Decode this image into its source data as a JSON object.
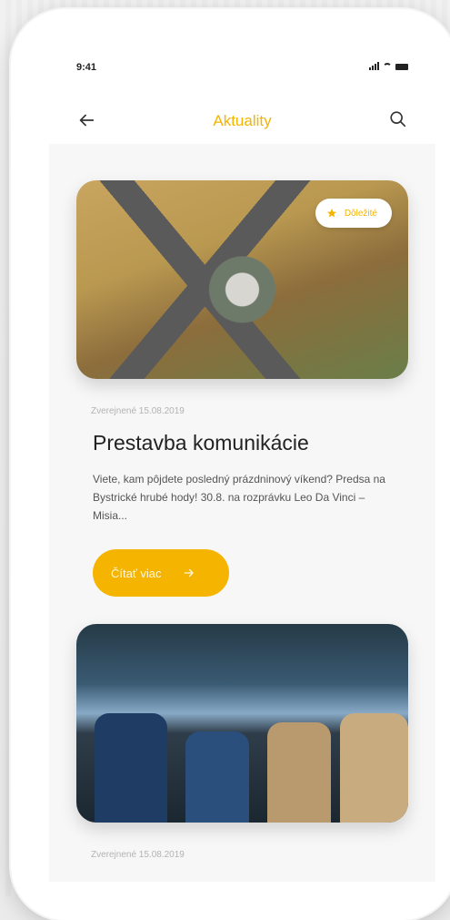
{
  "status": {
    "time": "9:41"
  },
  "header": {
    "title": "Aktuality"
  },
  "articles": [
    {
      "badge": "Dôležité",
      "meta": "Zverejnené 15.08.2019",
      "title": "Prestavba komunikácie",
      "excerpt": "Viete, kam pôjdete posledný prázdninový víkend? Predsa na Bystrické hrubé hody! 30.8. na rozprávku Leo Da Vinci – Misia...",
      "cta": "Čítať viac"
    },
    {
      "meta": "Zverejnené 15.08.2019",
      "title": ""
    }
  ],
  "colors": {
    "accent": "#f4b400",
    "background": "#f7f7f7"
  },
  "icons": {
    "back": "arrow-left-icon",
    "search": "search-icon",
    "badge": "star-icon",
    "cta": "arrow-right-icon"
  }
}
